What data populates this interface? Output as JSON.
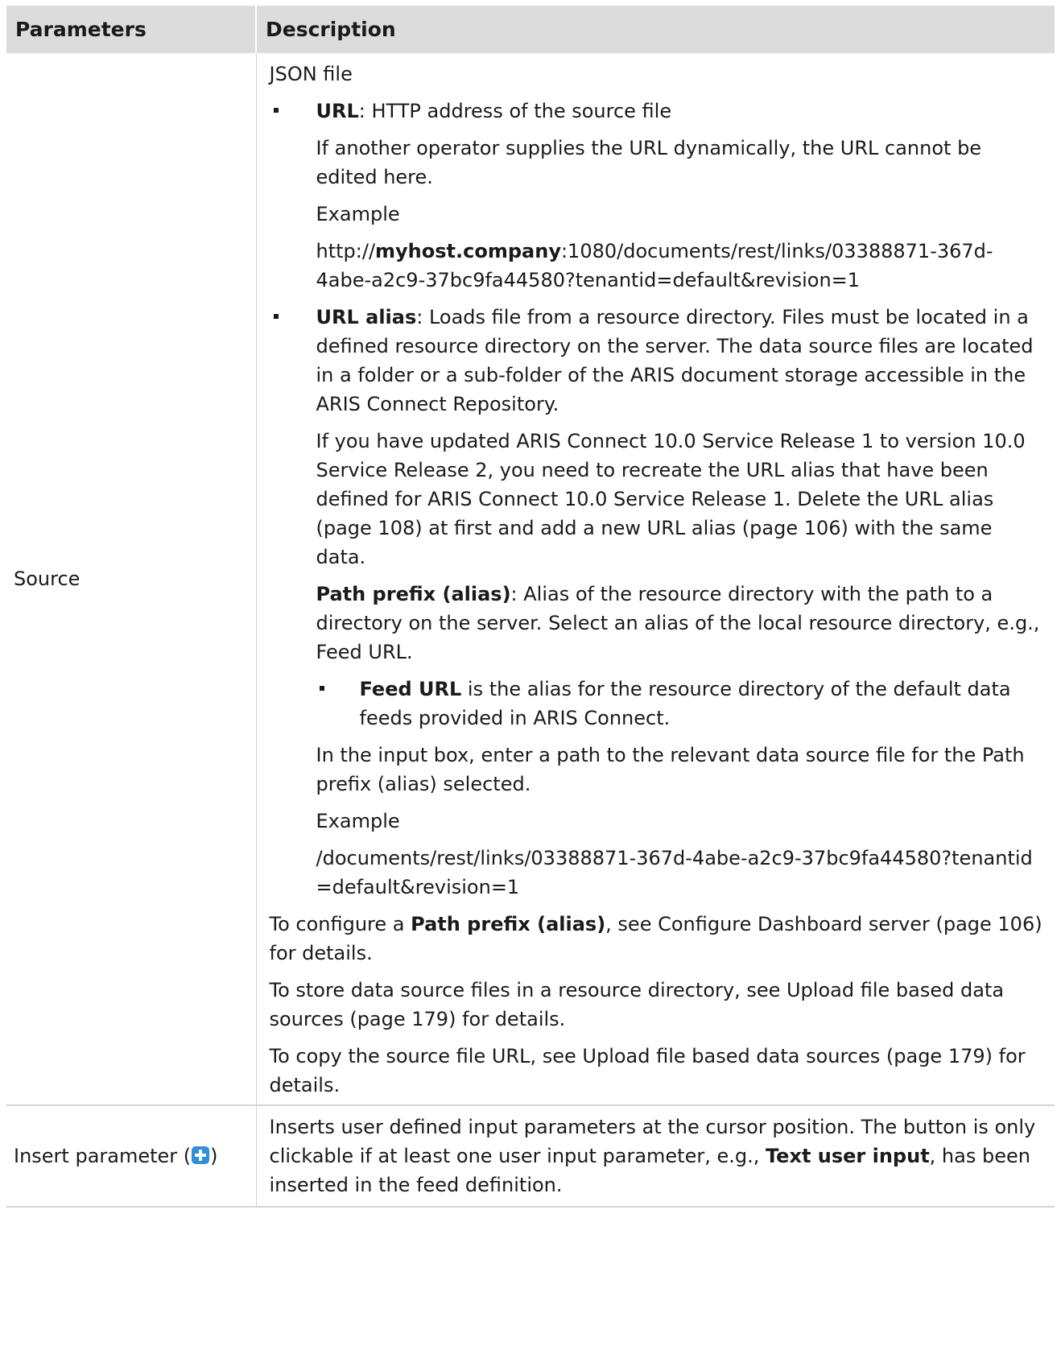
{
  "table": {
    "headers": [
      "Parameters",
      "Description"
    ],
    "rows": [
      {
        "param": "Source",
        "desc": {
          "intro": "JSON file",
          "url": {
            "label": "URL",
            "text": ": HTTP address of the source file",
            "note": "If another operator supplies the URL dynamically, the URL cannot be edited here.",
            "example_label": "Example",
            "example_pre": "http://",
            "example_bold": "myhost.company",
            "example_post": ":1080/documents/rest/links/03388871-367d-4abe-a2c9-37bc9fa44580?tenantid=default&revision=1"
          },
          "url_alias": {
            "label": "URL alias",
            "text": ": Loads file from a resource directory. Files must be located in a defined resource directory on the server. The data source files are located in a folder or a sub-folder of the ARIS document storage accessible in the ARIS Connect Repository.",
            "update_note": "If you have updated ARIS Connect 10.0 Service Release 1 to version 10.0 Service Release 2, you need to recreate the URL alias that have been defined for ARIS Connect 10.0 Service Release 1. Delete the URL alias (page 108) at first and add a new URL alias (page 106) with the same data.",
            "prefix_label": "Path prefix (alias)",
            "prefix_text": ": Alias of the resource directory with the path to a directory on the server. Select an alias of the local resource directory, e.g., Feed URL.",
            "feed_label": "Feed URL",
            "feed_text": " is the alias for the resource directory of the default data feeds provided in ARIS Connect.",
            "input_note": "In the input box, enter a path to the relevant data source file for the Path prefix (alias) selected.",
            "example_label": "Example",
            "example": "/documents/rest/links/03388871-367d-4abe-a2c9-37bc9fa44580?tenantid=default&revision=1"
          },
          "config_pre": "To configure a ",
          "config_bold": "Path prefix (alias)",
          "config_post": ", see Configure Dashboard server (page 106) for details.",
          "store_note": "To store data source files in a resource directory, see Upload file based data sources (page 179) for details.",
          "copy_note": "To copy the source file URL, see Upload file based data sources (page 179) for details."
        }
      },
      {
        "param_pre": "Insert parameter (",
        "param_icon": "plus-icon",
        "param_post": ")",
        "desc": {
          "pre": "Inserts user defined input parameters at the cursor position. The button is only clickable if at least one user input parameter, e.g., ",
          "bold": "Text user input",
          "post": ", has been inserted in the feed definition."
        }
      }
    ]
  }
}
